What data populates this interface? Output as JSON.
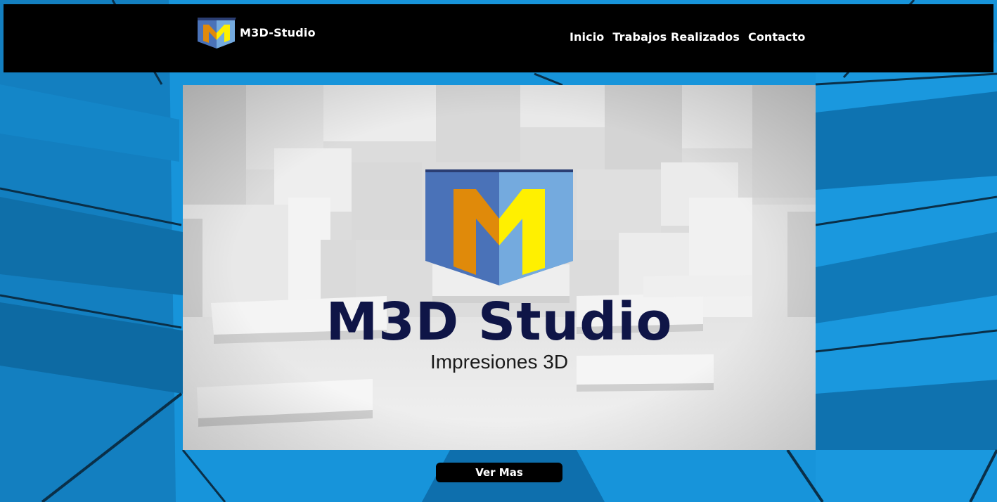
{
  "brand": {
    "name": "M3D-Studio",
    "logo_icon": "m3d-cube-logo"
  },
  "nav": {
    "items": [
      {
        "label": "Inicio"
      },
      {
        "label": "Trabajos Realizados"
      },
      {
        "label": "Contacto"
      }
    ]
  },
  "hero": {
    "title": "M3D Studio",
    "subtitle": "Impresiones 3D"
  },
  "cta": {
    "label": "Ver Mas"
  },
  "colors": {
    "background": "#1690d6",
    "navbar": "#000000",
    "logo_front": "#4a72b8",
    "logo_side": "#74aade",
    "logo_top": "#2b3e73",
    "logo_orange": "#e08a0a",
    "logo_yellow": "#fff000",
    "hero_title": "#0f1547"
  }
}
